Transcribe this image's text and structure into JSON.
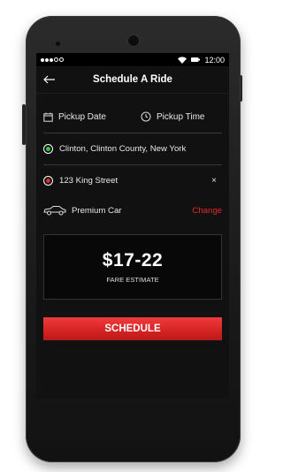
{
  "status_bar": {
    "time": "12:00"
  },
  "app_bar": {
    "title": "Schedule A Ride"
  },
  "form": {
    "pickup_date_label": "Pickup Date",
    "pickup_time_label": "Pickup Time",
    "pickup_location": "Clinton, Clinton County, New York",
    "dropoff_location": "123 King Street",
    "clear_icon": "×"
  },
  "car": {
    "type": "Premium Car",
    "change_label": "Change"
  },
  "fare": {
    "amount": "$17-22",
    "label": "FARE ESTIMATE"
  },
  "schedule_button_label": "SCHEDULE",
  "colors": {
    "accent_red": "#e02b2b",
    "pickup_dot": "#2ecc40",
    "dropoff_dot": "#e02b2b"
  },
  "icons": [
    "back-arrow-icon",
    "calendar-icon",
    "clock-icon",
    "pickup-dot-icon",
    "dropoff-dot-icon",
    "close-icon",
    "car-icon",
    "wifi-icon",
    "battery-icon"
  ]
}
